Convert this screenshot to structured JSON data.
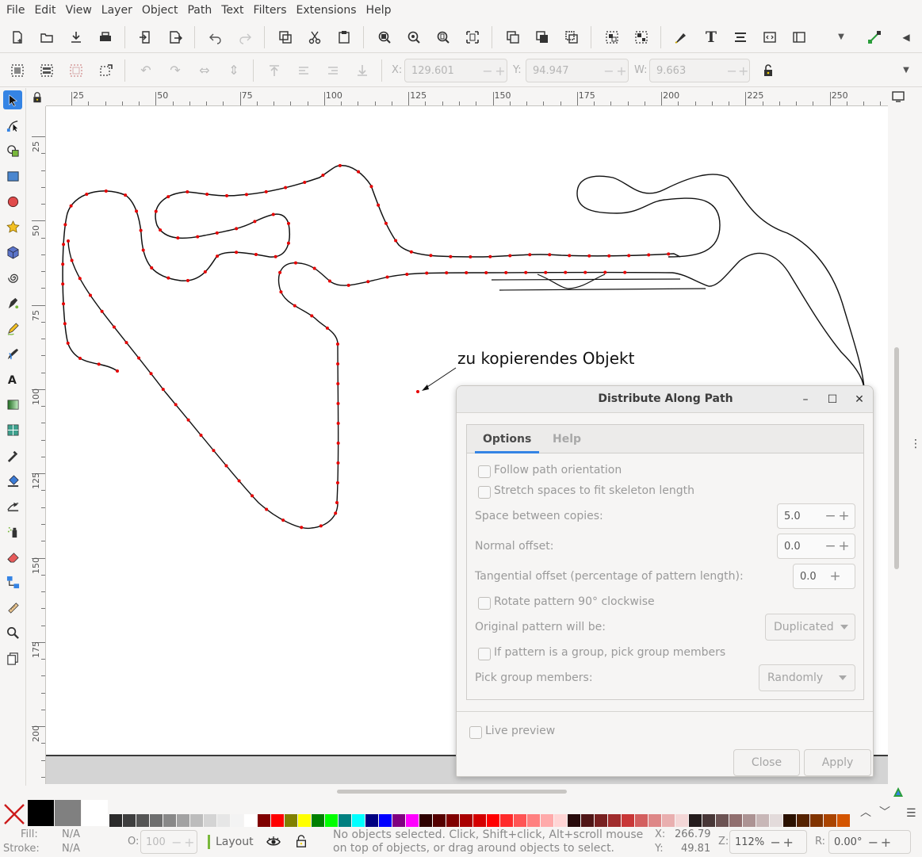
{
  "menu": [
    "File",
    "Edit",
    "View",
    "Layer",
    "Object",
    "Path",
    "Text",
    "Filters",
    "Extensions",
    "Help"
  ],
  "ctrlbar": {
    "x_label": "X:",
    "x_value": "129.601",
    "y_label": "Y:",
    "y_value": "94.947",
    "w_label": "W:",
    "w_value": "9.663"
  },
  "ruler": {
    "h_labels": [
      "25",
      "50",
      "75",
      "100",
      "125",
      "150",
      "175",
      "200",
      "225",
      "250"
    ],
    "v_labels": [
      "25",
      "50",
      "75",
      "100",
      "125",
      "150",
      "175",
      "200"
    ]
  },
  "canvas": {
    "annotation": "zu kopierendes Objekt"
  },
  "dialog": {
    "title": "Distribute Along Path",
    "tabs": [
      "Options",
      "Help"
    ],
    "follow_path_orientation": "Follow path orientation",
    "stretch_spaces": "Stretch spaces to fit skeleton length",
    "space_between_copies_label": "Space between copies:",
    "space_between_copies_value": "5.0",
    "normal_offset_label": "Normal offset:",
    "normal_offset_value": "0.0",
    "tangential_offset_label": "Tangential offset (percentage of pattern length):",
    "tangential_offset_value": "0.0",
    "rotate_pattern": "Rotate pattern 90° clockwise",
    "original_pattern_label": "Original pattern will be:",
    "original_pattern_value": "Duplicated",
    "pick_group_members_check": "If pattern is a group, pick group members",
    "pick_group_members_label": "Pick group members:",
    "pick_group_members_value": "Randomly",
    "live_preview": "Live preview",
    "close_button": "Close",
    "apply_button": "Apply"
  },
  "palette_colors": [
    "#2b2b2b",
    "#3e3e3e",
    "#555555",
    "#6e6e6e",
    "#888888",
    "#a2a2a2",
    "#bcbcbc",
    "#d4d4d4",
    "#e6e6e6",
    "#f3f3f3",
    "#ffffff",
    "#800000",
    "#ff0000",
    "#808000",
    "#ffff00",
    "#008000",
    "#00ff00",
    "#008080",
    "#00ffff",
    "#000080",
    "#0000ff",
    "#800080",
    "#ff00ff",
    "#2e0000",
    "#550000",
    "#800000",
    "#aa0000",
    "#d40000",
    "#ff0000",
    "#ff2a2a",
    "#ff5555",
    "#ff8080",
    "#ffaaaa",
    "#ffd5d5",
    "#280b0b",
    "#501616",
    "#782121",
    "#a02c2c",
    "#c83737",
    "#d35f5f",
    "#de8787",
    "#e9afaf",
    "#f4d7d7",
    "#241c1c",
    "#483737",
    "#6c5353",
    "#916f6f",
    "#ac9393",
    "#c8b7b7",
    "#e3dbdb",
    "#2b1100",
    "#552200",
    "#803300",
    "#aa4400",
    "#d45500"
  ],
  "status": {
    "fill_label": "Fill:",
    "fill_value": "N/A",
    "stroke_label": "Stroke:",
    "stroke_value": "N/A",
    "opacity_label": "O:",
    "opacity_value": "100",
    "layer_name": "Layout",
    "message": "No objects selected. Click, Shift+click, Alt+scroll mouse on top of objects, or drag around objects to select.",
    "x_label": "X:",
    "x_value": "266.79",
    "y_label": "Y:",
    "y_value": "49.81",
    "zoom_label": "Z:",
    "zoom_value": "112%",
    "rotation_label": "R:",
    "rotation_value": "0.00°"
  },
  "colors": {
    "accent": "#3584e4",
    "node": "#e60000"
  }
}
